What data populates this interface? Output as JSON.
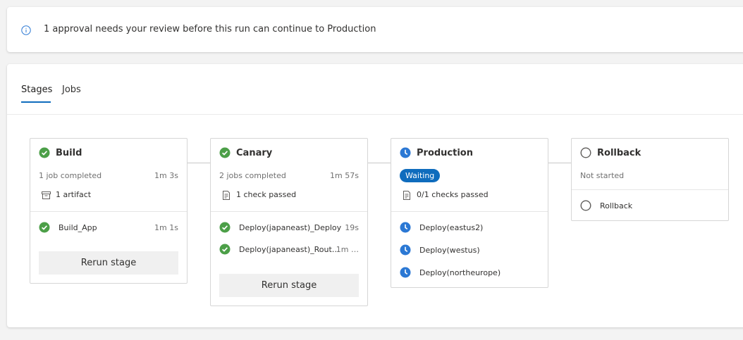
{
  "banner": {
    "message": "1 approval needs your review before this run can continue to Production"
  },
  "tabs": [
    {
      "label": "Stages"
    },
    {
      "label": "Jobs"
    }
  ],
  "stages": [
    {
      "name": "Build",
      "status": "succeeded",
      "summary": "1 job completed",
      "duration": "1m 3s",
      "detail": "1 artifact",
      "jobs": [
        {
          "name": "Build_App",
          "duration": "1m 1s",
          "status": "succeeded"
        }
      ],
      "rerun_label": "Rerun stage"
    },
    {
      "name": "Canary",
      "status": "succeeded",
      "summary": "2 jobs completed",
      "duration": "1m 57s",
      "detail": "1 check passed",
      "jobs": [
        {
          "name": "Deploy(japaneast)_Deploy",
          "duration": "19s",
          "status": "succeeded"
        },
        {
          "name": "Deploy(japaneast)_Rout…",
          "duration": "1m …",
          "status": "succeeded"
        }
      ],
      "rerun_label": "Rerun stage"
    },
    {
      "name": "Production",
      "status": "waiting",
      "badge": "Waiting",
      "detail": "0/1 checks passed",
      "jobs": [
        {
          "name": "Deploy(eastus2)",
          "status": "waiting"
        },
        {
          "name": "Deploy(westus)",
          "status": "waiting"
        },
        {
          "name": "Deploy(northeurope)",
          "status": "waiting"
        }
      ]
    },
    {
      "name": "Rollback",
      "status": "not-started",
      "summary": "Not started",
      "jobs": [
        {
          "name": "Rollback",
          "status": "not-started"
        }
      ]
    }
  ],
  "colors": {
    "success": "#4c9f48",
    "waiting": "#2b78d4",
    "accent": "#0f6cbd",
    "neutral": "#605e5c"
  }
}
